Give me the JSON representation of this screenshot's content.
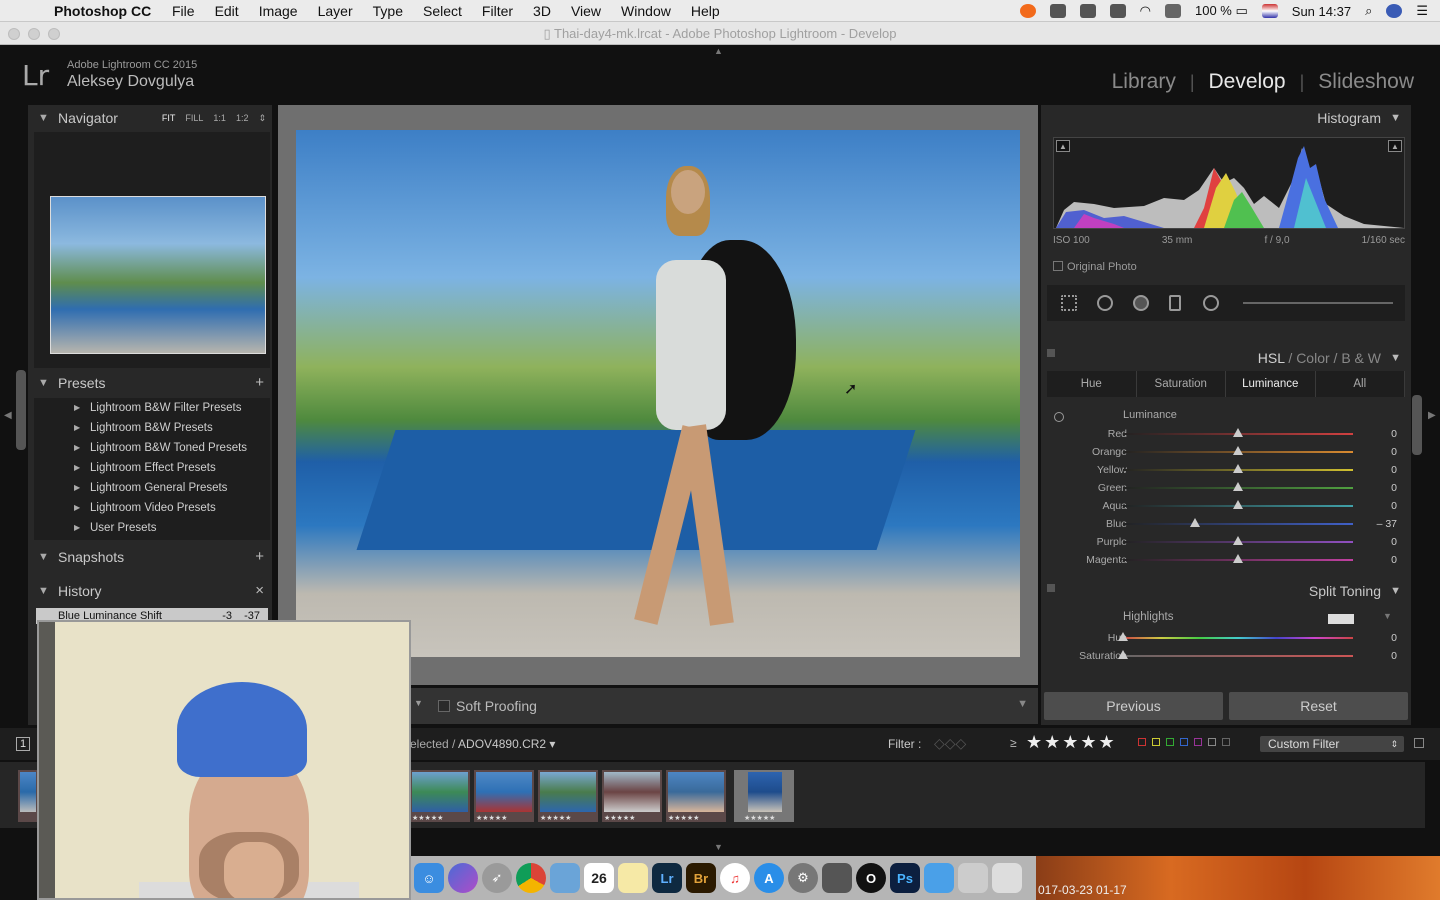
{
  "mac_menu": {
    "app_name": "Photoshop CC",
    "items": [
      "File",
      "Edit",
      "Image",
      "Layer",
      "Type",
      "Select",
      "Filter",
      "3D",
      "View",
      "Window",
      "Help"
    ],
    "battery": "100 %",
    "clock": "Sun 14:37"
  },
  "window_title": "Thai-day4-mk.lrcat - Adobe Photoshop Lightroom - Develop",
  "lightroom": {
    "logo": "Lr",
    "version": "Adobe Lightroom CC 2015",
    "user": "Aleksey Dovgulya",
    "modules": [
      "Library",
      "Develop",
      "Slideshow"
    ],
    "active_module": "Develop"
  },
  "left_panel": {
    "navigator": {
      "title": "Navigator",
      "options": [
        "FIT",
        "FILL",
        "1:1",
        "1:2"
      ]
    },
    "presets": {
      "title": "Presets",
      "items": [
        "Lightroom B&W Filter Presets",
        "Lightroom B&W Presets",
        "Lightroom B&W Toned Presets",
        "Lightroom Effect Presets",
        "Lightroom General Presets",
        "Lightroom Video Presets",
        "User Presets"
      ]
    },
    "snapshots": {
      "title": "Snapshots"
    },
    "history": {
      "title": "History",
      "row_label": "Blue Luminance Shift",
      "row_v1": "-3",
      "row_v2": "-37"
    }
  },
  "toolbar": {
    "soft_proofing": "Soft Proofing"
  },
  "right_panel": {
    "histogram": {
      "title": "Histogram",
      "iso": "ISO 100",
      "focal": "35 mm",
      "aperture": "f / 9,0",
      "shutter": "1/160 sec",
      "original_photo": "Original Photo"
    },
    "hsl_tabs": {
      "hsl": "HSL",
      "sep": "/",
      "color": "Color",
      "bw": "B & W"
    },
    "subtabs": [
      "Hue",
      "Saturation",
      "Luminance",
      "All"
    ],
    "active_subtab": "Luminance",
    "luminance": {
      "title": "Luminance",
      "sliders": [
        {
          "label": "Red",
          "value": "0",
          "pos": 0.5,
          "color": "#d04040"
        },
        {
          "label": "Orange",
          "value": "0",
          "pos": 0.5,
          "color": "#d88a30"
        },
        {
          "label": "Yellow",
          "value": "0",
          "pos": 0.5,
          "color": "#d0c030"
        },
        {
          "label": "Green",
          "value": "0",
          "pos": 0.5,
          "color": "#50a040"
        },
        {
          "label": "Aqua",
          "value": "0",
          "pos": 0.5,
          "color": "#40a0a8"
        },
        {
          "label": "Blue",
          "value": "– 37",
          "pos": 0.315,
          "color": "#4060c8"
        },
        {
          "label": "Purple",
          "value": "0",
          "pos": 0.5,
          "color": "#9050c0"
        },
        {
          "label": "Magenta",
          "value": "0",
          "pos": 0.5,
          "color": "#c040a0"
        }
      ]
    },
    "split_toning": {
      "title": "Split Toning",
      "highlights": "Highlights",
      "sliders": [
        {
          "label": "Hue",
          "value": "0",
          "pos": 0.0
        },
        {
          "label": "Saturation",
          "value": "0",
          "pos": 0.0
        }
      ]
    },
    "buttons": {
      "previous": "Previous",
      "reset": "Reset"
    }
  },
  "filmstrip_bar": {
    "selected": "elected / ",
    "filename": "ADOV4890.CR2 ▾",
    "filter_label": "Filter :",
    "rating_ge": "≥",
    "stars": "★★★★★",
    "custom_filter": "Custom Filter",
    "page_num": "1"
  },
  "filmstrip": {
    "stars": "★★★★★"
  },
  "dock": {
    "apps": [
      "Lr",
      "Br",
      "Ps"
    ],
    "calendar_day": "26"
  },
  "desktop": {
    "clock": "017-03-23 01-17"
  }
}
